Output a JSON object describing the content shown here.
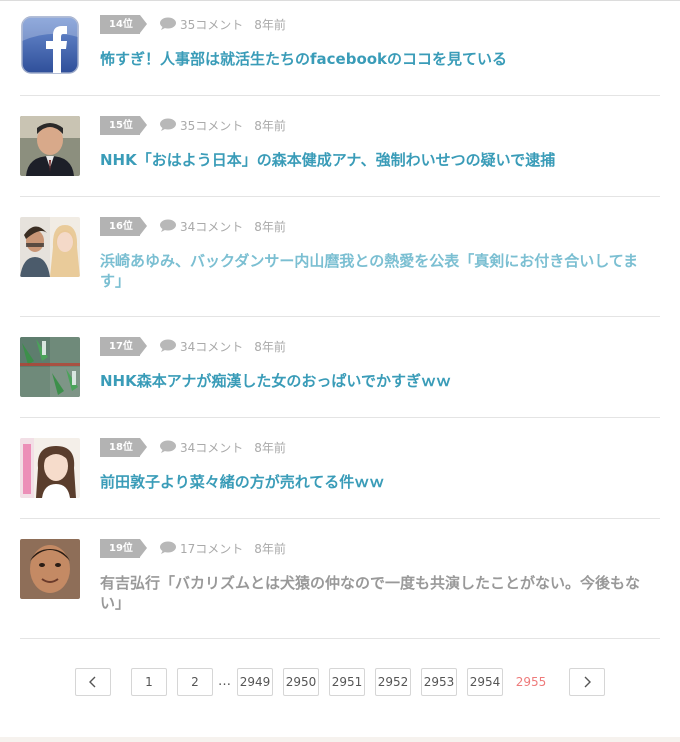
{
  "articles": [
    {
      "rank": "14位",
      "comments": "35コメント",
      "age": "8年前",
      "title": "怖すぎ！人事部は就活生たちのfacebookのココを見ている",
      "thumb_icon": "facebook-logo-icon"
    },
    {
      "rank": "15位",
      "comments": "35コメント",
      "age": "8年前",
      "title": "NHK「おはよう日本」の森本健成アナ、強制わいせつの疑いで逮捕",
      "thumb_icon": "person-photo"
    },
    {
      "rank": "16位",
      "comments": "34コメント",
      "age": "8年前",
      "title": "浜崎あゆみ、バックダンサー内山麿我との熱愛を公表「真剣にお付き合いしてます」",
      "thumb_icon": "two-person-photo"
    },
    {
      "rank": "17位",
      "comments": "34コメント",
      "age": "8年前",
      "title": "NHK森本アナが痴漢した女のおっぱいでかすぎｗｗ",
      "thumb_icon": "news-screenshot-photo"
    },
    {
      "rank": "18位",
      "comments": "34コメント",
      "age": "8年前",
      "title": "前田敦子より菜々緒の方が売れてる件ｗｗ",
      "thumb_icon": "woman-photo"
    },
    {
      "rank": "19位",
      "comments": "17コメント",
      "age": "8年前",
      "title": "有吉弘行「バカリズムとは犬猿の仲なので一度も共演したことがない。今後もない」",
      "thumb_icon": "man-photo"
    }
  ],
  "pagination": {
    "prev": "‹",
    "next": "›",
    "pages": [
      "1",
      "2",
      "2949",
      "2950",
      "2951",
      "2952",
      "2953",
      "2954"
    ],
    "ellipsis": "…",
    "current": "2955"
  },
  "colors": {
    "link": "#3a9cb8",
    "rank_badge": "#b3b3b3",
    "current_page": "#ee7b7b"
  }
}
